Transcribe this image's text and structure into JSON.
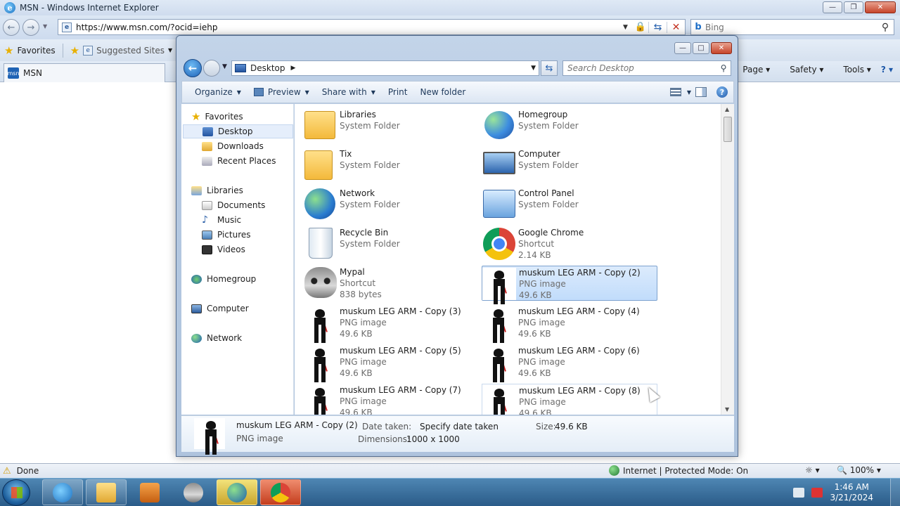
{
  "ie": {
    "title": "MSN - Windows Internet Explorer",
    "url": "https://www.msn.com/?ocid=iehp",
    "search_placeholder": "Bing",
    "favorites_label": "Favorites",
    "suggested_sites_label": "Suggested Sites",
    "tab_title": "MSN",
    "commands": {
      "page": "Page",
      "safety": "Safety",
      "tools": "Tools"
    },
    "status": {
      "text": "Done",
      "zone": "Internet | Protected Mode: On",
      "zoom": "100%"
    }
  },
  "explorer": {
    "breadcrumb": "Desktop",
    "search_placeholder": "Search Desktop",
    "toolbar": {
      "organize": "Organize",
      "preview": "Preview",
      "share_with": "Share with",
      "print": "Print",
      "new_folder": "New folder"
    },
    "sidebar": {
      "favorites": "Favorites",
      "desktop": "Desktop",
      "downloads": "Downloads",
      "recent_places": "Recent Places",
      "libraries": "Libraries",
      "documents": "Documents",
      "music": "Music",
      "pictures": "Pictures",
      "videos": "Videos",
      "homegroup": "Homegroup",
      "computer": "Computer",
      "network": "Network"
    },
    "files": [
      {
        "name": "Libraries",
        "type": "System Folder",
        "size": ""
      },
      {
        "name": "Homegroup",
        "type": "System Folder",
        "size": ""
      },
      {
        "name": "Tix",
        "type": "System Folder",
        "size": ""
      },
      {
        "name": "Computer",
        "type": "System Folder",
        "size": ""
      },
      {
        "name": "Network",
        "type": "System Folder",
        "size": ""
      },
      {
        "name": "Control Panel",
        "type": "System Folder",
        "size": ""
      },
      {
        "name": "Recycle Bin",
        "type": "System Folder",
        "size": ""
      },
      {
        "name": "Google Chrome",
        "type": "Shortcut",
        "size": "2.14 KB"
      },
      {
        "name": "Mypal",
        "type": "Shortcut",
        "size": "838 bytes"
      },
      {
        "name": "muskum LEG ARM - Copy (2)",
        "type": "PNG image",
        "size": "49.6 KB"
      },
      {
        "name": "muskum LEG ARM - Copy (3)",
        "type": "PNG image",
        "size": "49.6 KB"
      },
      {
        "name": "muskum LEG ARM - Copy (4)",
        "type": "PNG image",
        "size": "49.6 KB"
      },
      {
        "name": "muskum LEG ARM - Copy (5)",
        "type": "PNG image",
        "size": "49.6 KB"
      },
      {
        "name": "muskum LEG ARM - Copy (6)",
        "type": "PNG image",
        "size": "49.6 KB"
      },
      {
        "name": "muskum LEG ARM - Copy (7)",
        "type": "PNG image",
        "size": "49.6 KB"
      },
      {
        "name": "muskum LEG ARM - Copy (8)",
        "type": "PNG image",
        "size": "49.6 KB"
      }
    ],
    "details": {
      "name": "muskum LEG ARM - Copy (2)",
      "type": "PNG image",
      "date_taken_label": "Date taken:",
      "date_taken_value": "Specify date taken",
      "dimensions_label": "Dimensions:",
      "dimensions_value": "1000 x 1000",
      "size_label": "Size:",
      "size_value": "49.6 KB"
    }
  },
  "taskbar": {
    "time": "1:46 AM",
    "date": "3/21/2024"
  }
}
